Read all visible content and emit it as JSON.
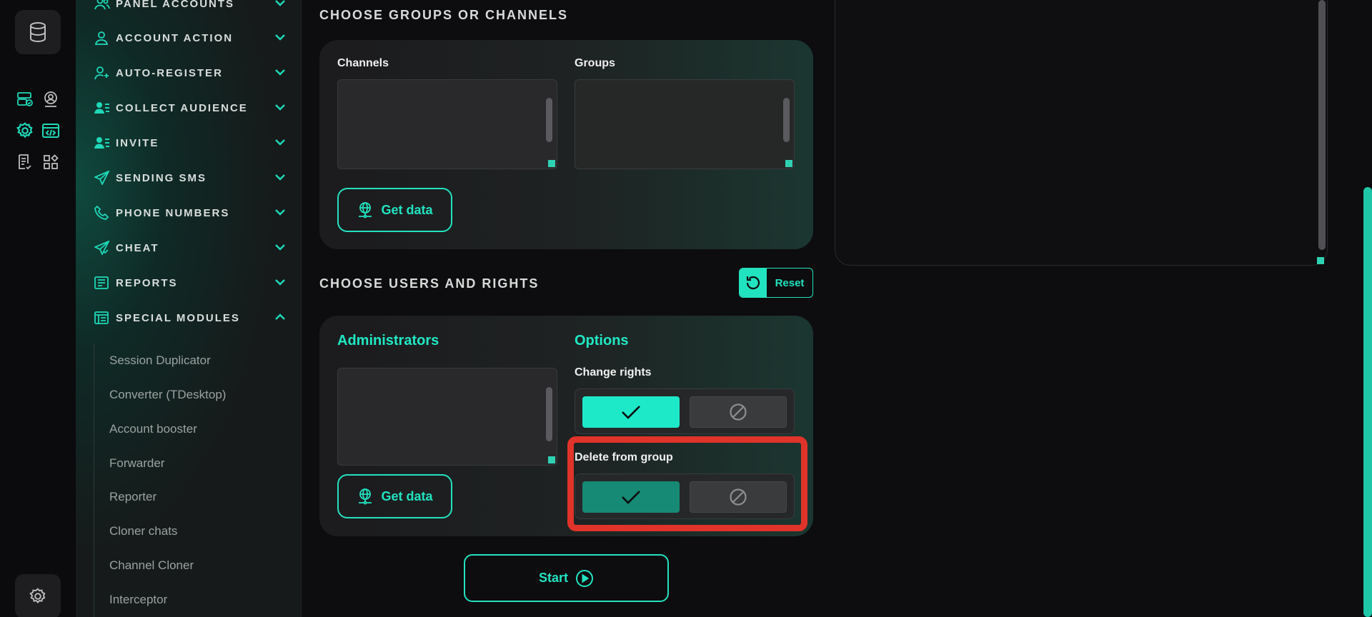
{
  "rail": {
    "icons": [
      "database-icon",
      "server-check-icon",
      "user-pin-icon",
      "settings-gear-icon",
      "code-window-icon",
      "doc-check-icon",
      "widgets-icon",
      "gear-icon"
    ]
  },
  "sidebar": {
    "items": [
      {
        "label": "PANEL ACCOUNTS",
        "icon": "users-icon",
        "expanded": false
      },
      {
        "label": "ACCOUNT ACTION",
        "icon": "user-icon",
        "expanded": false
      },
      {
        "label": "AUTO-REGISTER",
        "icon": "user-plus-icon",
        "expanded": false
      },
      {
        "label": "COLLECT AUDIENCE",
        "icon": "user-list-icon",
        "expanded": false
      },
      {
        "label": "INVITE",
        "icon": "user-list-icon",
        "expanded": false
      },
      {
        "label": "SENDING SMS",
        "icon": "send-icon",
        "expanded": false
      },
      {
        "label": "PHONE NUMBERS",
        "icon": "phone-icon",
        "expanded": false
      },
      {
        "label": "CHEAT",
        "icon": "send-check-icon",
        "expanded": false
      },
      {
        "label": "REPORTS",
        "icon": "report-icon",
        "expanded": false
      },
      {
        "label": "SPECIAL MODULES",
        "icon": "modules-icon",
        "expanded": true
      }
    ],
    "submenu": [
      "Session Duplicator",
      "Converter (TDesktop)",
      "Account booster",
      "Forwarder",
      "Reporter",
      "Cloner chats",
      "Channel Cloner",
      "Interceptor"
    ]
  },
  "groups_section": {
    "title": "CHOOSE GROUPS OR CHANNELS",
    "channels_label": "Channels",
    "groups_label": "Groups",
    "get_data_label": "Get data"
  },
  "users_section": {
    "title": "CHOOSE USERS AND RIGHTS",
    "reset_label": "Reset",
    "administrators_label": "Administrators",
    "options_label": "Options",
    "change_rights_label": "Change rights",
    "delete_from_group_label": "Delete from group",
    "get_data_label": "Get data"
  },
  "start_label": "Start",
  "colors": {
    "accent": "#22e3c0",
    "highlight": "#e0332a",
    "toggle_active": "#1de9c9",
    "toggle_active_dim": "#168a74"
  }
}
